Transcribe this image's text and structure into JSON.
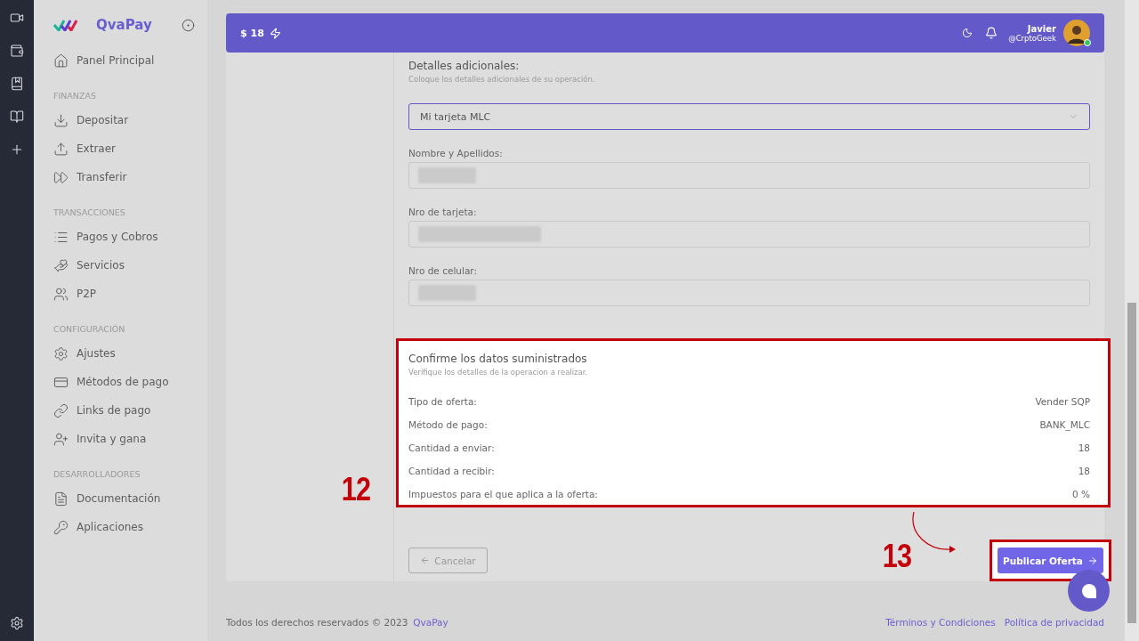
{
  "brand": {
    "name": "QvaPay"
  },
  "sidebar": {
    "top_item": {
      "label": "Panel Principal",
      "selected": false
    },
    "sections": [
      {
        "title": "FINANZAS",
        "items": [
          {
            "label": "Depositar"
          },
          {
            "label": "Extraer"
          },
          {
            "label": "Transferir"
          }
        ]
      },
      {
        "title": "TRANSACCIONES",
        "items": [
          {
            "label": "Pagos y Cobros"
          },
          {
            "label": "Servicios"
          },
          {
            "label": "P2P"
          }
        ]
      },
      {
        "title": "CONFIGURACIÓN",
        "items": [
          {
            "label": "Ajustes"
          },
          {
            "label": "Métodos de pago"
          },
          {
            "label": "Links de pago"
          },
          {
            "label": "Invita y gana"
          }
        ]
      },
      {
        "title": "DESARROLLADORES",
        "items": [
          {
            "label": "Documentación"
          },
          {
            "label": "Aplicaciones"
          }
        ]
      }
    ]
  },
  "header": {
    "balance": "$ 18",
    "user_name": "Javier",
    "user_handle": "@CrptoGeek",
    "online": true
  },
  "details": {
    "title": "Detalles adicionales:",
    "subtitle": "Coloque los detalles adicionales de su operación.",
    "select_value": "Mi tarjeta MLC",
    "fields": [
      {
        "label": "Nombre y Apellidos:",
        "redacted": true
      },
      {
        "label": "Nro de tarjeta:",
        "redacted": true
      },
      {
        "label": "Nro de celular:",
        "redacted": true
      }
    ]
  },
  "confirm": {
    "title": "Confirme los datos suministrados",
    "subtitle": "Verifique los detalles de la operacion a realizar.",
    "rows": [
      {
        "label": "Tipo de oferta:",
        "value": "Vender SQP"
      },
      {
        "label": "Método de pago:",
        "value": "BANK_MLC"
      },
      {
        "label": "Cantidad a enviar:",
        "value": "18"
      },
      {
        "label": "Cantidad a recibir:",
        "value": "18"
      },
      {
        "label": "Impuestos para el que aplica a la oferta:",
        "value": "0 %"
      }
    ]
  },
  "actions": {
    "cancel": "Cancelar",
    "submit": "Publicar Oferta"
  },
  "annotations": [
    {
      "number": "12"
    },
    {
      "number": "13"
    }
  ],
  "footer": {
    "copyright": "Todos los derechos reservados © 2023",
    "brand_link": "QvaPay",
    "links": [
      "Términos y Condiciones",
      "Política de privacidad"
    ]
  }
}
